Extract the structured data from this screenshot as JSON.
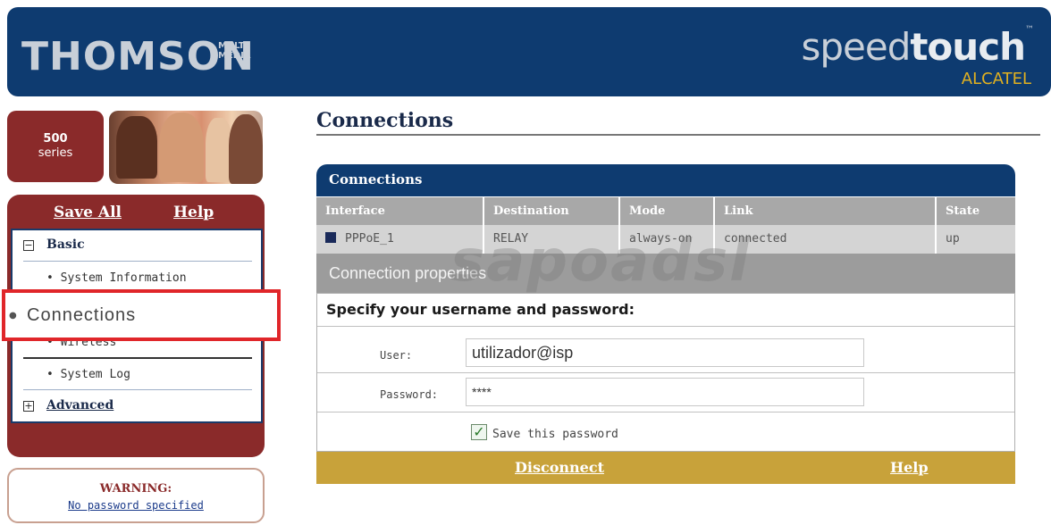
{
  "header": {
    "brand_left": "THOMSON",
    "brand_left_sub": "MULTI MEDIA",
    "brand_right_light": "speed",
    "brand_right_bold": "touch",
    "brand_right_tm": "™",
    "brand_right_sub": "ALCATEL"
  },
  "series": {
    "number": "500",
    "label": "series"
  },
  "nav": {
    "save_all": "Save All",
    "help": "Help",
    "basic": "Basic",
    "system_information": "• System Information",
    "connections": "Connections",
    "wireless_partial": "• Wireless",
    "system_log": "• System Log",
    "advanced": "Advanced",
    "expand_minus": "−",
    "expand_plus": "+"
  },
  "warning": {
    "title": "WARNING:",
    "link": "No password specified"
  },
  "main": {
    "page_title": "Connections",
    "panel_title": "Connections",
    "table": {
      "headers": [
        "Interface",
        "Destination",
        "Mode",
        "Link",
        "State"
      ],
      "rows": [
        [
          "PPPoE_1",
          "RELAY",
          "always-on",
          "connected",
          "up"
        ]
      ]
    },
    "watermark": "sapoadsl",
    "properties_title": "Connection properties",
    "form_title": "Specify your username and password:",
    "user_label": "User:",
    "user_value": "utilizador@isp",
    "password_label": "Password:",
    "password_value": "****",
    "save_password_label": "Save this password",
    "save_password_checked": true,
    "disconnect": "Disconnect",
    "help": "Help"
  },
  "colors": {
    "header_blue": "#0e3b70",
    "nav_red": "#8a2a2a",
    "highlight_red": "#e0262a",
    "action_gold": "#c8a23a",
    "table_head_gray": "#a8a8a8",
    "table_row_gray": "#d4d4d4"
  }
}
